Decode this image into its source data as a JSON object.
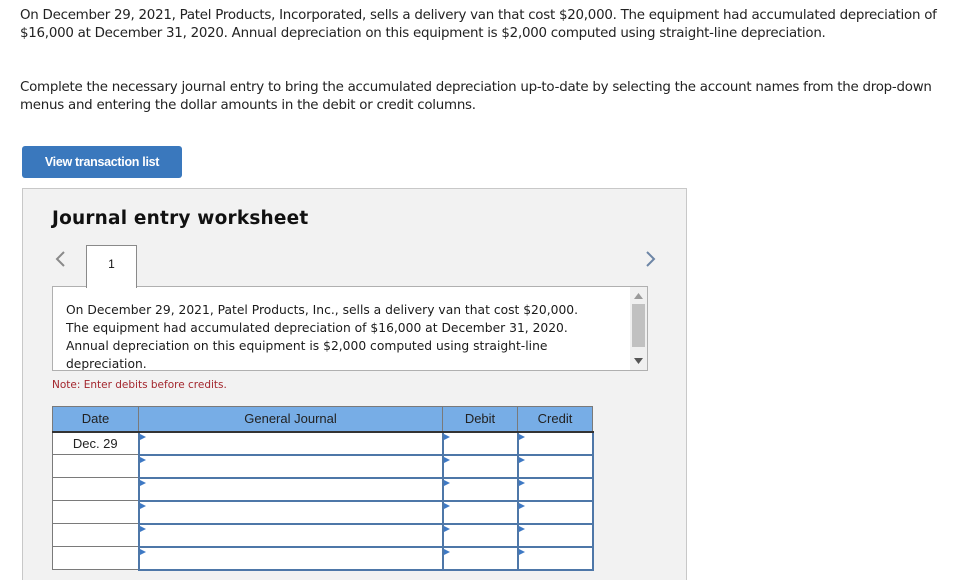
{
  "problem": {
    "paragraph1": "On December 29, 2021, Patel Products, Incorporated, sells a delivery van that cost $20,000. The equipment had accumulated depreciation of $16,000 at December 31, 2020. Annual depreciation on this equipment is $2,000 computed using straight-line depreciation.",
    "paragraph2": "Complete the necessary journal entry to bring the accumulated depreciation up-to-date by selecting the account names from the drop-down menus and entering the dollar amounts in the debit or credit columns."
  },
  "buttons": {
    "view_transaction_list": "View transaction list"
  },
  "worksheet": {
    "title": "Journal entry worksheet",
    "active_tab": "1",
    "tabs": [
      "1"
    ],
    "nav": {
      "prev_icon": "chevron-left-icon",
      "next_icon": "chevron-right-icon"
    },
    "description": "On December 29, 2021, Patel Products, Inc., sells a delivery van that cost $20,000. The equipment had accumulated depreciation of $16,000 at December 31, 2020. Annual depreciation on this equipment is $2,000 computed using straight-line depreciation.",
    "note": "Note: Enter debits before credits.",
    "table": {
      "headers": {
        "date": "Date",
        "general_journal": "General Journal",
        "debit": "Debit",
        "credit": "Credit"
      },
      "rows": [
        {
          "date": "Dec. 29",
          "account": "",
          "debit": "",
          "credit": ""
        },
        {
          "date": "",
          "account": "",
          "debit": "",
          "credit": ""
        },
        {
          "date": "",
          "account": "",
          "debit": "",
          "credit": ""
        },
        {
          "date": "",
          "account": "",
          "debit": "",
          "credit": ""
        },
        {
          "date": "",
          "account": "",
          "debit": "",
          "credit": ""
        },
        {
          "date": "",
          "account": "",
          "debit": "",
          "credit": ""
        }
      ]
    }
  },
  "colors": {
    "button_bg": "#3a78bd",
    "header_bg": "#77ade6",
    "note_text": "#a3262d",
    "panel_bg": "#f2f2f2",
    "input_border": "#4e77a8"
  }
}
